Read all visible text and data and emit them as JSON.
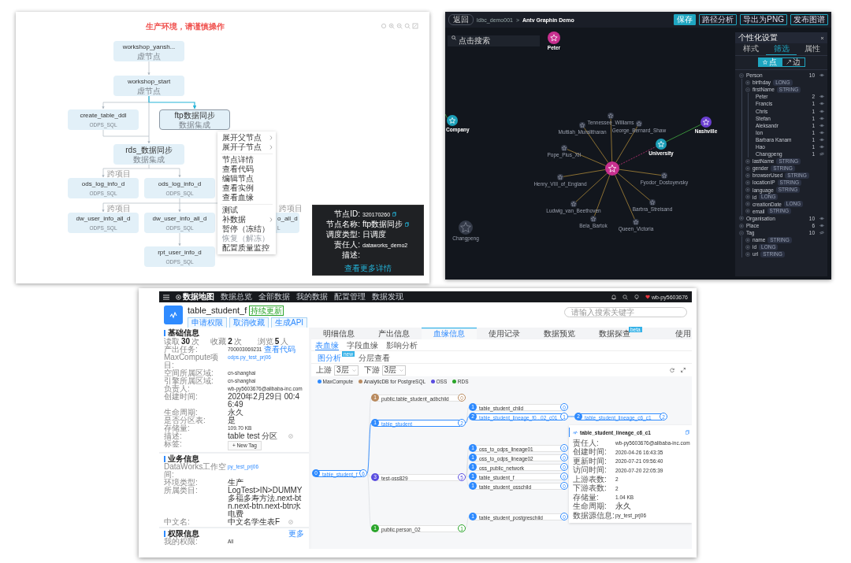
{
  "dag_panel": {
    "title": "生产环境，请谨慎操作",
    "nodes": [
      {
        "name": "workshop_yansh...",
        "type": "虚节点",
        "selected": false
      },
      {
        "name": "workshop_start",
        "type": "虚节点",
        "selected": false
      },
      {
        "name": "create_table_ddl",
        "type": "ODPS_SQL",
        "selected": false
      },
      {
        "name": "ftp数据同步",
        "type": "数据集成",
        "selected": true
      },
      {
        "name": "rds_数据同步",
        "type": "数据集成",
        "selected": false
      },
      {
        "name": "ods_log_info_d",
        "type": "ODPS_SQL",
        "selected": false
      },
      {
        "name": "ods_log_info_d",
        "type": "ODPS_SQL",
        "selected": false
      },
      {
        "name": "dw_user_info_all_d",
        "type": "ODPS_SQL",
        "selected": false
      },
      {
        "name": "dw_user_info_all_d",
        "type": "ODPS_SQL",
        "selected": false
      },
      {
        "name": "o_all_d",
        "type": "L",
        "selected": false
      },
      {
        "name": "rpt_user_info_d",
        "type": "ODPS_SQL",
        "selected": false
      }
    ],
    "cross_project_labels": [
      "跨项目",
      "跨项目",
      "跨项目"
    ],
    "context_menu": [
      [
        {
          "label": "展开父节点",
          "submenu": true,
          "disabled": false
        },
        {
          "label": "展开子节点",
          "submenu": true,
          "disabled": false
        }
      ],
      [
        {
          "label": "节点详情",
          "submenu": false,
          "disabled": false
        },
        {
          "label": "查看代码",
          "submenu": false,
          "disabled": false
        },
        {
          "label": "编辑节点",
          "submenu": false,
          "disabled": false
        },
        {
          "label": "查看实例",
          "submenu": false,
          "disabled": false
        },
        {
          "label": "查看血缘",
          "submenu": false,
          "disabled": false
        }
      ],
      [
        {
          "label": "测试",
          "submenu": false,
          "disabled": false
        },
        {
          "label": "补数据",
          "submenu": true,
          "disabled": false
        },
        {
          "label": "暂停（冻结）",
          "submenu": false,
          "disabled": false
        },
        {
          "label": "恢复（解冻）",
          "submenu": false,
          "disabled": true
        },
        {
          "label": "配置质量监控",
          "submenu": false,
          "disabled": false
        }
      ]
    ],
    "node_info": {
      "rows": [
        {
          "label": "节点ID:",
          "value": "320170260",
          "copyable": true
        },
        {
          "label": "节点名称:",
          "value": "ftp数据同步",
          "copyable": true
        },
        {
          "label": "调度类型:",
          "value": "日调度",
          "copyable": false
        },
        {
          "label": "责任人:",
          "value": "dataworks_demo2",
          "copyable": false
        },
        {
          "label": "描述:",
          "copyable": false
        }
      ],
      "link": "查看更多详情"
    }
  },
  "graph_panel": {
    "back_button": "返回",
    "breadcrumb": [
      "ldbc_demo001",
      "Antv Graphin Demo"
    ],
    "separator": ">",
    "actions": [
      {
        "label": "保存",
        "primary": true
      },
      {
        "label": "路径分析",
        "primary": false
      },
      {
        "label": "导出为PNG",
        "primary": false
      },
      {
        "label": "发布图谱",
        "primary": false
      }
    ],
    "search": {
      "placeholder": "点击搜索"
    },
    "nodes": [
      {
        "label": "Peter",
        "color": "#c8308f"
      },
      {
        "label": "Company",
        "color": "#1c9fb8"
      },
      {
        "label": "Nashville",
        "color": "#6b3fd1"
      },
      {
        "label": "University",
        "color": "#1c9fb8"
      },
      {
        "color": "#c8308f"
      },
      {
        "label": "Tennessee_Williams",
        "color": "#343a48"
      },
      {
        "label": "Muttiah_Muralitharan",
        "color": "#343a48"
      },
      {
        "label": "George_Bernard_Shaw",
        "color": "#343a48"
      },
      {
        "label": "Pope_Pius_XII",
        "color": "#343a48"
      },
      {
        "label": "Henry_VIII_of_England",
        "color": "#343a48"
      },
      {
        "label": "Fyodor_Dostoyevsky",
        "color": "#343a48"
      },
      {
        "label": "Ludwig_van_Beethoven",
        "color": "#343a48"
      },
      {
        "label": "Barbra_Streisand",
        "color": "#343a48"
      },
      {
        "label": "Bela_Bartok",
        "color": "#343a48"
      },
      {
        "label": "Queen_Victoria",
        "color": "#343a48"
      },
      {
        "label": "Changpeng",
        "color": "#343a48"
      }
    ],
    "settings": {
      "title": "个性化设置",
      "tabs": [
        {
          "label": "样式",
          "selected": false
        },
        {
          "label": "筛选",
          "selected": true
        },
        {
          "label": "属性",
          "selected": false
        }
      ],
      "toggle": [
        {
          "label": "点",
          "selected": true
        },
        {
          "label": "边",
          "selected": false
        }
      ],
      "tree": [
        {
          "name": "Person",
          "count": "10",
          "expanded": true,
          "visible": true,
          "children": [
            {
              "name": "birthday",
              "type": "LONG",
              "expanded": false
            },
            {
              "name": "firstName",
              "type": "STRING",
              "expanded": true,
              "children": [
                {
                  "name": "Peter",
                  "count": "2",
                  "visible": true
                },
                {
                  "name": "Francis",
                  "count": "1",
                  "visible": true
                },
                {
                  "name": "Chris",
                  "count": "1",
                  "visible": true
                },
                {
                  "name": "Stefan",
                  "count": "1",
                  "visible": true
                },
                {
                  "name": "Aleksandr",
                  "count": "1",
                  "visible": true
                },
                {
                  "name": "Ion",
                  "count": "1",
                  "visible": true
                },
                {
                  "name": "Barbara Kanam",
                  "count": "1",
                  "visible": true
                },
                {
                  "name": "Hao",
                  "count": "1",
                  "visible": true
                },
                {
                  "name": "Changpeng",
                  "count": "1",
                  "visible": false
                }
              ]
            },
            {
              "name": "lastName",
              "type": "STRING",
              "expanded": false
            },
            {
              "name": "gender",
              "type": "STRING",
              "expanded": false
            },
            {
              "name": "browserUsed",
              "type": "STRING",
              "expanded": false
            },
            {
              "name": "locationIP",
              "type": "STRING",
              "expanded": false
            },
            {
              "name": "language",
              "type": "STRING",
              "expanded": false
            },
            {
              "name": "id",
              "type": "LONG",
              "expanded": false
            },
            {
              "name": "creationDate",
              "type": "LONG",
              "expanded": false
            },
            {
              "name": "email",
              "type": "STRING",
              "expanded": false
            }
          ]
        },
        {
          "name": "Organisation",
          "count": "10",
          "expanded": false,
          "visible": true
        },
        {
          "name": "Place",
          "count": "6",
          "expanded": false,
          "visible": true
        },
        {
          "name": "Tag",
          "count": "10",
          "expanded": true,
          "visible": false,
          "children": [
            {
              "name": "name",
              "type": "STRING",
              "expanded": false
            },
            {
              "name": "id",
              "type": "LONG",
              "expanded": false
            },
            {
              "name": "url",
              "type": "STRING",
              "expanded": false
            }
          ]
        }
      ]
    }
  },
  "catalog": {
    "nav": {
      "logo": "数据地图",
      "items": [
        "数据总览",
        "全部数据",
        "我的数据",
        "配置管理",
        "数据发现"
      ],
      "user": "wb-py5603676"
    },
    "header": {
      "title": "table_student_f",
      "badge": "持续更新",
      "actions": [
        "申请权限",
        "取消收藏",
        "生成API"
      ],
      "search": {
        "placeholder": "请输入搜索关键字"
      }
    },
    "basic": {
      "title": "基础信息",
      "stats": [
        {
          "label": "读取",
          "value": "30",
          "unit": "次"
        },
        {
          "label": "收藏",
          "value": "2",
          "unit": "次"
        },
        {
          "label": "浏览",
          "value": "5",
          "unit": "人"
        }
      ],
      "rows": [
        {
          "label": "产出任务:",
          "value": "700003069231",
          "kind": "text",
          "action": "查看代码"
        },
        {
          "label": "MaxCompute项目:",
          "value": "odps.py_test_prj06",
          "kind": "link"
        },
        {
          "label": "空间所属区域:",
          "value": "cn-shanghai",
          "kind": "text"
        },
        {
          "label": "引擎所属区域:",
          "value": "cn-shanghai",
          "kind": "text"
        },
        {
          "label": "负责人:",
          "value": "wb-py5603676@alibaba-inc.com",
          "kind": "text"
        },
        {
          "label": "创建时间:",
          "value": "2020年2月29日 00:46:49",
          "kind": "text"
        },
        {
          "label": "生命周期:",
          "value": "永久",
          "kind": "text"
        },
        {
          "label": "是否分区表:",
          "value": "是",
          "kind": "text"
        },
        {
          "label": "存储量:",
          "value": "109.70 KB",
          "kind": "text"
        },
        {
          "label": "描述:",
          "value": "table test 分区",
          "kind": "editable"
        },
        {
          "label": "标签:",
          "value": "+ New Tag",
          "kind": "button"
        }
      ]
    },
    "business": {
      "title": "业务信息",
      "rows": [
        {
          "label": "DataWorks工作空间:",
          "value": "py_test_prj06",
          "kind": "link"
        },
        {
          "label": "环境类型:",
          "value": "生产",
          "kind": "text"
        },
        {
          "label": "所属类目:",
          "value": "LogTest>IN>DUMMY多福多寿方法.next-btn.next-btn.next-btn水电费",
          "kind": "text"
        },
        {
          "label": "中文名:",
          "value": "中文名学生表F",
          "kind": "editable"
        }
      ]
    },
    "permission": {
      "title": "权限信息",
      "more": "更多",
      "rows": [
        {
          "label": "我的权限:",
          "value": "All",
          "kind": "text"
        }
      ]
    },
    "detail": {
      "tabs": [
        {
          "label": "明细信息",
          "selected": false
        },
        {
          "label": "产出信息",
          "selected": false
        },
        {
          "label": "血缘信息",
          "selected": true
        },
        {
          "label": "使用记录",
          "selected": false
        },
        {
          "label": "数据预览",
          "selected": false
        },
        {
          "label": "数据探查",
          "selected": false,
          "badge": "beta"
        },
        {
          "label": "使用",
          "selected": false
        }
      ],
      "subtabs": [
        {
          "label": "表血缘",
          "selected": true
        },
        {
          "label": "字段血缘",
          "selected": false
        },
        {
          "label": "影响分析",
          "selected": false
        }
      ],
      "views": [
        {
          "label": "图分析",
          "selected": true,
          "badge": "new"
        },
        {
          "label": "分层查看",
          "selected": false
        }
      ],
      "upstream": {
        "label": "上游",
        "value": "3层"
      },
      "downstream": {
        "label": "下游",
        "value": "3层"
      },
      "legend": [
        {
          "label": "MaxCompute",
          "color": "#2f8bff"
        },
        {
          "label": "AnalyticDB for PostgreSQL",
          "color": "#b98a5e"
        },
        {
          "label": "OSS",
          "color": "#5a4de0"
        },
        {
          "label": "RDS",
          "color": "#2aa52a"
        }
      ],
      "lineage": [
        {
          "label": "table_student_f",
          "level": "0",
          "count": "6",
          "color": "#2f8bff",
          "highlighted": true
        },
        {
          "label": "public.table_student_adbchild",
          "level": "1",
          "count": "0",
          "color": "#b98a5e",
          "highlighted": false
        },
        {
          "label": "table_student",
          "level": "1",
          "count": "2",
          "color": "#2f8bff",
          "highlighted": true
        },
        {
          "label": "test-oss829",
          "level": "3",
          "count": "5",
          "color": "#5a4de0",
          "highlighted": false
        },
        {
          "label": "public.person_02",
          "level": "1",
          "count": "1",
          "color": "#2aa52a",
          "highlighted": false
        },
        {
          "label": "table_student_child",
          "level": "1",
          "count": "0",
          "color": "#2f8bff",
          "highlighted": false
        },
        {
          "label": "table_student_lineage_f0...02_c01",
          "level": "2",
          "count": "1",
          "color": "#2f8bff",
          "highlighted": true
        },
        {
          "label": "table_student_lineage_c6_c1",
          "level": "2",
          "count": "2",
          "color": "#2f8bff",
          "highlighted": true
        },
        {
          "label": "oss_to_odps_lineage01",
          "level": "1",
          "count": "0",
          "color": "#2f8bff",
          "highlighted": false
        },
        {
          "label": "oss_to_odps_lineage02",
          "level": "1",
          "count": "0",
          "color": "#2f8bff",
          "highlighted": false
        },
        {
          "label": "oss_public_network",
          "level": "1",
          "count": "0",
          "color": "#2f8bff",
          "highlighted": false
        },
        {
          "label": "table_student_f",
          "level": "1",
          "count": "0",
          "color": "#2f8bff",
          "highlighted": false
        },
        {
          "label": "table_student_osschild",
          "level": "1",
          "count": "0",
          "color": "#2f8bff",
          "highlighted": false
        },
        {
          "label": "table_student_postgreschild",
          "level": "1",
          "count": "0",
          "color": "#2f8bff",
          "highlighted": false
        }
      ],
      "tooltip": {
        "title": "table_student_lineage_c6_c1",
        "rows": [
          {
            "label": "责任人:",
            "value": "wb-py5603676@alibaba-inc.com"
          },
          {
            "label": "创建时间:",
            "value": "2020-04-26 16:43:35"
          },
          {
            "label": "更新时间:",
            "value": "2020-07-21 09:56:40"
          },
          {
            "label": "访问时间:",
            "value": "2020-07-20 22:05:39"
          },
          {
            "label": "上游表数:",
            "value": "2"
          },
          {
            "label": "下游表数:",
            "value": "2"
          },
          {
            "label": "存储量:",
            "value": "1.04 KB"
          },
          {
            "label": "生命周期:",
            "value": "永久"
          },
          {
            "label": "数据源信息:",
            "value": "py_test_prj06"
          }
        ]
      }
    }
  }
}
